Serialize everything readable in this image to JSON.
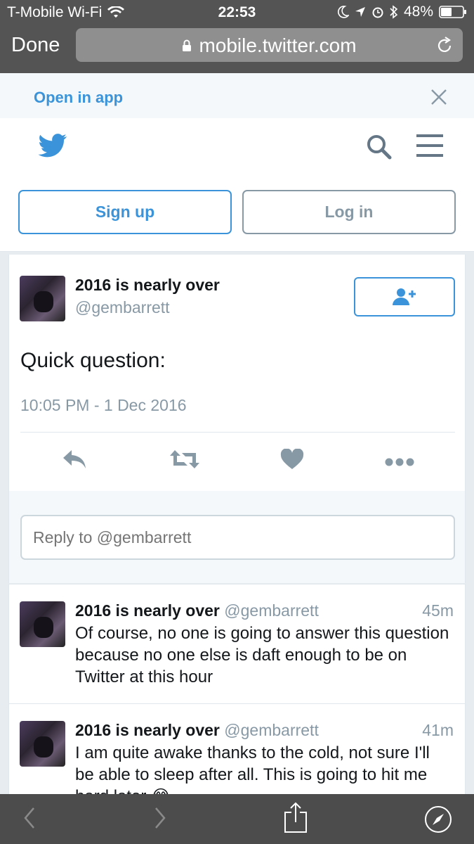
{
  "status": {
    "carrier": "T-Mobile Wi-Fi",
    "time": "22:53",
    "battery": "48%"
  },
  "browser": {
    "done_label": "Done",
    "url": "mobile.twitter.com"
  },
  "banner": {
    "open_in_app": "Open in app"
  },
  "header": {
    "signup_label": "Sign up",
    "login_label": "Log in"
  },
  "tweet": {
    "name": "2016 is nearly over",
    "handle": "@gembarrett",
    "text": "Quick question:",
    "timestamp": "10:05 PM - 1 Dec 2016"
  },
  "reply_box": {
    "placeholder": "Reply to @gembarrett"
  },
  "replies": [
    {
      "name": "2016 is nearly over",
      "handle": "@gembarrett",
      "time": "45m",
      "text": "Of course, no one is going to answer this question because no one else is daft enough to be on Twitter at this hour"
    },
    {
      "name": "2016 is nearly over",
      "handle": "@gembarrett",
      "time": "41m",
      "text": "I am quite awake thanks to the cold, not sure I'll be able to sleep after all. This is going to hit me hard later 😂"
    }
  ],
  "colors": {
    "brand": "#3b94d9",
    "muted": "#8899a6",
    "text": "#14171a"
  }
}
